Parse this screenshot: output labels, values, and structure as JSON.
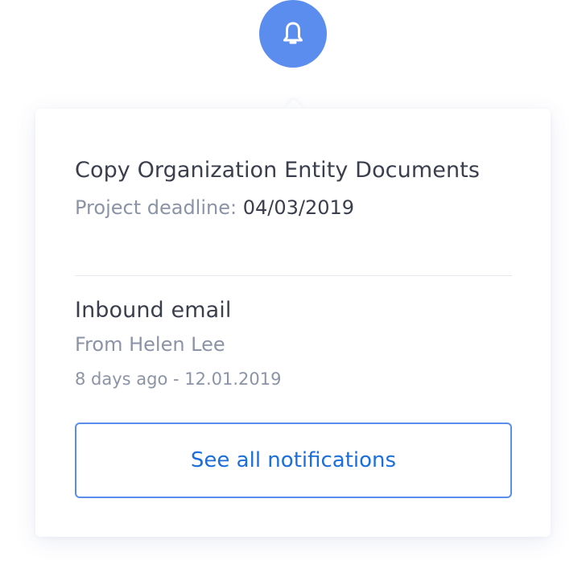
{
  "colors": {
    "accent": "#5b8def",
    "button_text": "#1b6fdc",
    "button_border": "#5b8def",
    "primary_text": "#3b3f4d",
    "muted_text": "#8b93a6"
  },
  "bell": {
    "icon": "bell-icon"
  },
  "notifications": [
    {
      "title": "Copy Organization Entity Documents",
      "meta_label": "Project deadline:",
      "meta_value": "04/03/2019"
    },
    {
      "title": "Inbound email",
      "from": "From Helen Lee",
      "time": "8 days ago - 12.01.2019"
    }
  ],
  "footer": {
    "see_all_label": "See all notifications"
  }
}
